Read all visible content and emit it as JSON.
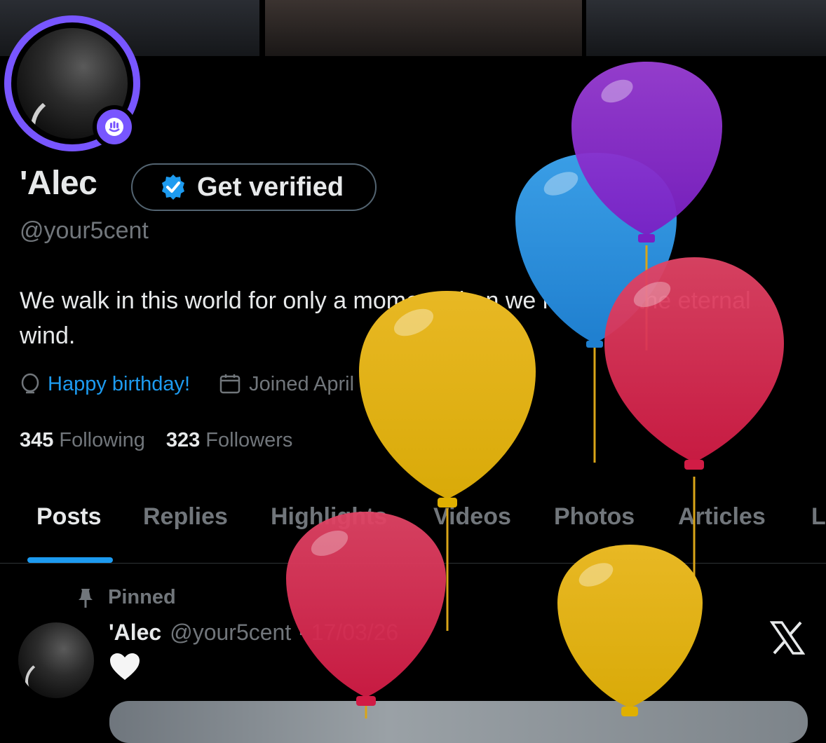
{
  "profile": {
    "display_name": "'Alec",
    "handle": "@your5cent",
    "bio": "We walk in this world for only a moment, then we return to the eternal wind.",
    "location_text": "Happy birthday!",
    "joined_text": "Joined April 2021 ›",
    "verify_button_label": "Get verified",
    "following_count": "345",
    "following_label": "Following",
    "followers_count": "323",
    "followers_label": "Followers"
  },
  "tabs": [
    {
      "label": "Posts",
      "active": true
    },
    {
      "label": "Replies"
    },
    {
      "label": "Highlights"
    },
    {
      "label": "Videos"
    },
    {
      "label": "Photos"
    },
    {
      "label": "Articles"
    },
    {
      "label": "L"
    }
  ],
  "pinned_post": {
    "pinned_label": "Pinned",
    "author_name": "'Alec",
    "author_handle_date": "@your5cent · 17/03/26",
    "body_emoji": "🤍"
  },
  "icons": {
    "verified": "verified-badge-icon",
    "location": "location-pin-icon",
    "calendar": "calendar-icon",
    "pin": "pin-icon",
    "x": "x-logo-icon",
    "spaces": "spaces-mic-icon"
  },
  "colors": {
    "accent": "#1d9bf0",
    "spaces_ring": "#7856ff",
    "muted": "#71767b"
  }
}
